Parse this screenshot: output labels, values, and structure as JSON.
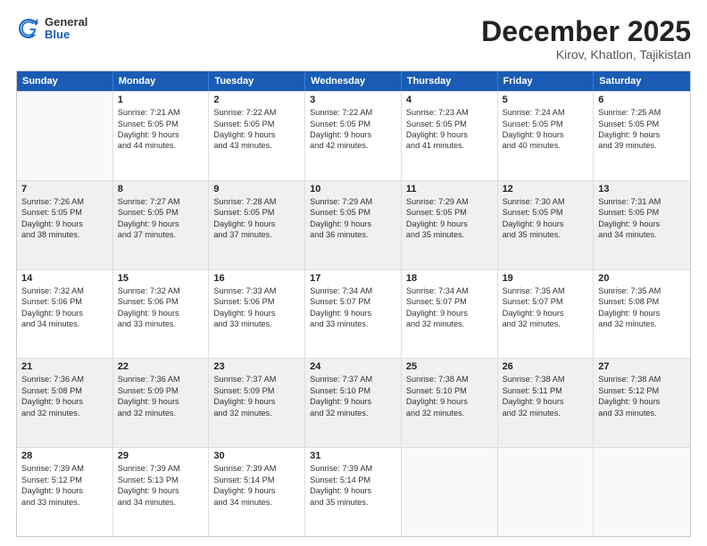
{
  "header": {
    "logo_general": "General",
    "logo_blue": "Blue",
    "month_title": "December 2025",
    "location": "Kirov, Khatlon, Tajikistan"
  },
  "days_of_week": [
    "Sunday",
    "Monday",
    "Tuesday",
    "Wednesday",
    "Thursday",
    "Friday",
    "Saturday"
  ],
  "weeks": [
    [
      {
        "day": "",
        "sunrise": "",
        "sunset": "",
        "daylight": "",
        "shaded": false,
        "empty": true
      },
      {
        "day": "1",
        "sunrise": "Sunrise: 7:21 AM",
        "sunset": "Sunset: 5:05 PM",
        "daylight": "Daylight: 9 hours and 44 minutes.",
        "shaded": false,
        "empty": false
      },
      {
        "day": "2",
        "sunrise": "Sunrise: 7:22 AM",
        "sunset": "Sunset: 5:05 PM",
        "daylight": "Daylight: 9 hours and 43 minutes.",
        "shaded": false,
        "empty": false
      },
      {
        "day": "3",
        "sunrise": "Sunrise: 7:22 AM",
        "sunset": "Sunset: 5:05 PM",
        "daylight": "Daylight: 9 hours and 42 minutes.",
        "shaded": false,
        "empty": false
      },
      {
        "day": "4",
        "sunrise": "Sunrise: 7:23 AM",
        "sunset": "Sunset: 5:05 PM",
        "daylight": "Daylight: 9 hours and 41 minutes.",
        "shaded": false,
        "empty": false
      },
      {
        "day": "5",
        "sunrise": "Sunrise: 7:24 AM",
        "sunset": "Sunset: 5:05 PM",
        "daylight": "Daylight: 9 hours and 40 minutes.",
        "shaded": false,
        "empty": false
      },
      {
        "day": "6",
        "sunrise": "Sunrise: 7:25 AM",
        "sunset": "Sunset: 5:05 PM",
        "daylight": "Daylight: 9 hours and 39 minutes.",
        "shaded": false,
        "empty": false
      }
    ],
    [
      {
        "day": "7",
        "sunrise": "Sunrise: 7:26 AM",
        "sunset": "Sunset: 5:05 PM",
        "daylight": "Daylight: 9 hours and 38 minutes.",
        "shaded": true,
        "empty": false
      },
      {
        "day": "8",
        "sunrise": "Sunrise: 7:27 AM",
        "sunset": "Sunset: 5:05 PM",
        "daylight": "Daylight: 9 hours and 37 minutes.",
        "shaded": true,
        "empty": false
      },
      {
        "day": "9",
        "sunrise": "Sunrise: 7:28 AM",
        "sunset": "Sunset: 5:05 PM",
        "daylight": "Daylight: 9 hours and 37 minutes.",
        "shaded": true,
        "empty": false
      },
      {
        "day": "10",
        "sunrise": "Sunrise: 7:29 AM",
        "sunset": "Sunset: 5:05 PM",
        "daylight": "Daylight: 9 hours and 36 minutes.",
        "shaded": true,
        "empty": false
      },
      {
        "day": "11",
        "sunrise": "Sunrise: 7:29 AM",
        "sunset": "Sunset: 5:05 PM",
        "daylight": "Daylight: 9 hours and 35 minutes.",
        "shaded": true,
        "empty": false
      },
      {
        "day": "12",
        "sunrise": "Sunrise: 7:30 AM",
        "sunset": "Sunset: 5:05 PM",
        "daylight": "Daylight: 9 hours and 35 minutes.",
        "shaded": true,
        "empty": false
      },
      {
        "day": "13",
        "sunrise": "Sunrise: 7:31 AM",
        "sunset": "Sunset: 5:05 PM",
        "daylight": "Daylight: 9 hours and 34 minutes.",
        "shaded": true,
        "empty": false
      }
    ],
    [
      {
        "day": "14",
        "sunrise": "Sunrise: 7:32 AM",
        "sunset": "Sunset: 5:06 PM",
        "daylight": "Daylight: 9 hours and 34 minutes.",
        "shaded": false,
        "empty": false
      },
      {
        "day": "15",
        "sunrise": "Sunrise: 7:32 AM",
        "sunset": "Sunset: 5:06 PM",
        "daylight": "Daylight: 9 hours and 33 minutes.",
        "shaded": false,
        "empty": false
      },
      {
        "day": "16",
        "sunrise": "Sunrise: 7:33 AM",
        "sunset": "Sunset: 5:06 PM",
        "daylight": "Daylight: 9 hours and 33 minutes.",
        "shaded": false,
        "empty": false
      },
      {
        "day": "17",
        "sunrise": "Sunrise: 7:34 AM",
        "sunset": "Sunset: 5:07 PM",
        "daylight": "Daylight: 9 hours and 33 minutes.",
        "shaded": false,
        "empty": false
      },
      {
        "day": "18",
        "sunrise": "Sunrise: 7:34 AM",
        "sunset": "Sunset: 5:07 PM",
        "daylight": "Daylight: 9 hours and 32 minutes.",
        "shaded": false,
        "empty": false
      },
      {
        "day": "19",
        "sunrise": "Sunrise: 7:35 AM",
        "sunset": "Sunset: 5:07 PM",
        "daylight": "Daylight: 9 hours and 32 minutes.",
        "shaded": false,
        "empty": false
      },
      {
        "day": "20",
        "sunrise": "Sunrise: 7:35 AM",
        "sunset": "Sunset: 5:08 PM",
        "daylight": "Daylight: 9 hours and 32 minutes.",
        "shaded": false,
        "empty": false
      }
    ],
    [
      {
        "day": "21",
        "sunrise": "Sunrise: 7:36 AM",
        "sunset": "Sunset: 5:08 PM",
        "daylight": "Daylight: 9 hours and 32 minutes.",
        "shaded": true,
        "empty": false
      },
      {
        "day": "22",
        "sunrise": "Sunrise: 7:36 AM",
        "sunset": "Sunset: 5:09 PM",
        "daylight": "Daylight: 9 hours and 32 minutes.",
        "shaded": true,
        "empty": false
      },
      {
        "day": "23",
        "sunrise": "Sunrise: 7:37 AM",
        "sunset": "Sunset: 5:09 PM",
        "daylight": "Daylight: 9 hours and 32 minutes.",
        "shaded": true,
        "empty": false
      },
      {
        "day": "24",
        "sunrise": "Sunrise: 7:37 AM",
        "sunset": "Sunset: 5:10 PM",
        "daylight": "Daylight: 9 hours and 32 minutes.",
        "shaded": true,
        "empty": false
      },
      {
        "day": "25",
        "sunrise": "Sunrise: 7:38 AM",
        "sunset": "Sunset: 5:10 PM",
        "daylight": "Daylight: 9 hours and 32 minutes.",
        "shaded": true,
        "empty": false
      },
      {
        "day": "26",
        "sunrise": "Sunrise: 7:38 AM",
        "sunset": "Sunset: 5:11 PM",
        "daylight": "Daylight: 9 hours and 32 minutes.",
        "shaded": true,
        "empty": false
      },
      {
        "day": "27",
        "sunrise": "Sunrise: 7:38 AM",
        "sunset": "Sunset: 5:12 PM",
        "daylight": "Daylight: 9 hours and 33 minutes.",
        "shaded": true,
        "empty": false
      }
    ],
    [
      {
        "day": "28",
        "sunrise": "Sunrise: 7:39 AM",
        "sunset": "Sunset: 5:12 PM",
        "daylight": "Daylight: 9 hours and 33 minutes.",
        "shaded": false,
        "empty": false
      },
      {
        "day": "29",
        "sunrise": "Sunrise: 7:39 AM",
        "sunset": "Sunset: 5:13 PM",
        "daylight": "Daylight: 9 hours and 34 minutes.",
        "shaded": false,
        "empty": false
      },
      {
        "day": "30",
        "sunrise": "Sunrise: 7:39 AM",
        "sunset": "Sunset: 5:14 PM",
        "daylight": "Daylight: 9 hours and 34 minutes.",
        "shaded": false,
        "empty": false
      },
      {
        "day": "31",
        "sunrise": "Sunrise: 7:39 AM",
        "sunset": "Sunset: 5:14 PM",
        "daylight": "Daylight: 9 hours and 35 minutes.",
        "shaded": false,
        "empty": false
      },
      {
        "day": "",
        "sunrise": "",
        "sunset": "",
        "daylight": "",
        "shaded": false,
        "empty": true
      },
      {
        "day": "",
        "sunrise": "",
        "sunset": "",
        "daylight": "",
        "shaded": false,
        "empty": true
      },
      {
        "day": "",
        "sunrise": "",
        "sunset": "",
        "daylight": "",
        "shaded": false,
        "empty": true
      }
    ]
  ]
}
